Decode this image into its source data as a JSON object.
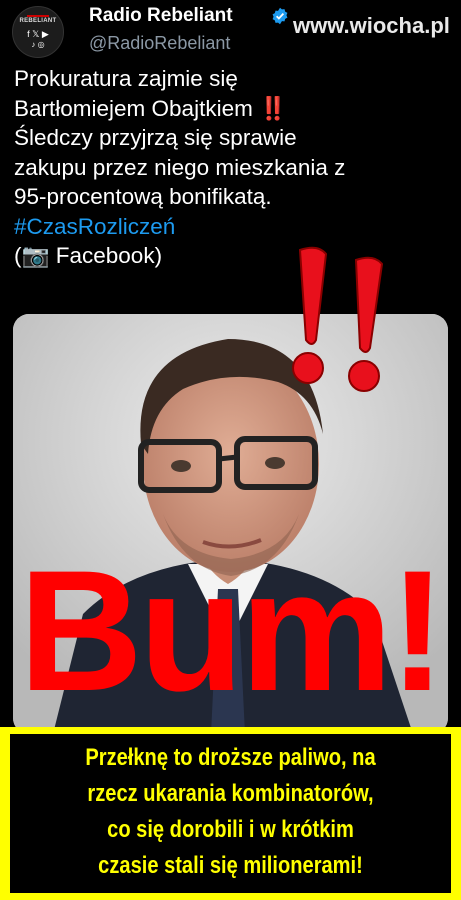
{
  "header": {
    "name": "Radio Rebeliant",
    "handle": "@RadioRebeliant",
    "avatar_brand": "REBELIANT",
    "avatar_socials_top": "f 𝕏 ▶",
    "avatar_socials_bottom": "♪ ◎",
    "verified_icon": "verified-badge-icon",
    "accent_color": "#1d9bf0"
  },
  "watermark": "www.wiocha.pl",
  "tweet": {
    "line1": "Prokuratura zajmie się",
    "line2_text": "Bartłomiejem Obajtkiem ",
    "line2_emoji": "‼️",
    "line3": "Śledczy przyjrzą się sprawie",
    "line4": "zakupu przez niego mieszkania z",
    "line5": "95-procentową bonifikatą.",
    "hashtag": "#CzasRozliczeń",
    "source": "(📷 Facebook)"
  },
  "overlay": {
    "big_marks": "‼",
    "bum": "Bum!"
  },
  "caption": {
    "line1": "Przełknę to droższe paliwo, na",
    "line2": "rzecz ukarania kombinatorów,",
    "line3": "co się dorobili i w krótkim",
    "line4": "czasie stali się milionerami!"
  },
  "colors": {
    "red": "#ff0000",
    "yellow": "#ffff00",
    "handle_gray": "#8b98a5"
  }
}
